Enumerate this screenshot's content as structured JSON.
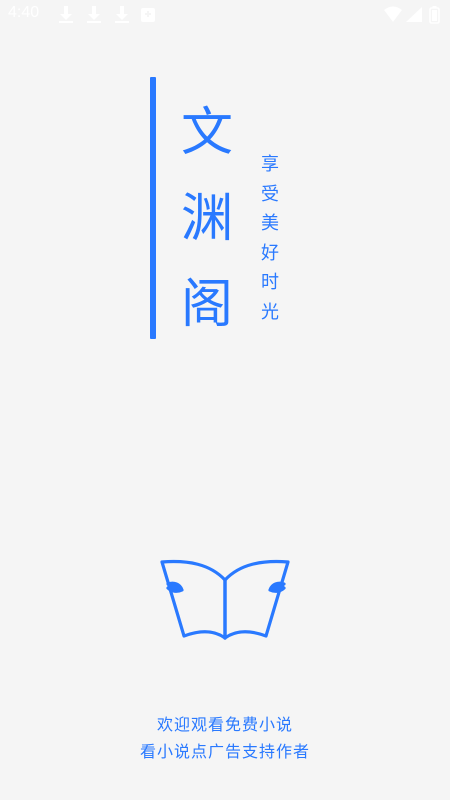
{
  "status_bar": {
    "time": "4:40",
    "icons": [
      "download-icon",
      "download-icon",
      "download-icon",
      "notification-icon",
      "wifi-icon",
      "signal-icon",
      "battery-icon"
    ]
  },
  "app": {
    "title_chars": [
      "文",
      "渊",
      "阁"
    ],
    "slogan_chars": [
      "享",
      "受",
      "美",
      "好",
      "时",
      "光"
    ],
    "logo_icon": "open-book-icon"
  },
  "footer": {
    "line1": "欢迎观看免费小说",
    "line2": "看小说点广告支持作者"
  },
  "colors": {
    "accent": "#2979ff",
    "background": "#f5f5f5",
    "status_bar_text": "#ffffff"
  }
}
